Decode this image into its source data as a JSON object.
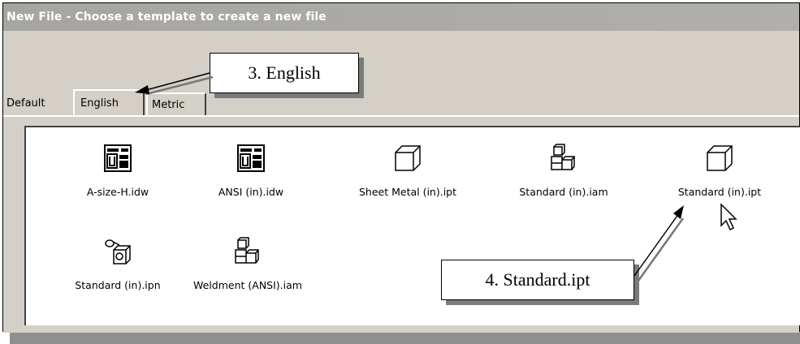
{
  "window": {
    "title": "New File - Choose a template to create a new file"
  },
  "tabs": [
    {
      "label": "Default",
      "selected": false
    },
    {
      "label": "English",
      "selected": true
    },
    {
      "label": "Metric",
      "selected": false
    }
  ],
  "templates": [
    {
      "label": "A-size-H.idw",
      "icon": "drawing-icon"
    },
    {
      "label": "ANSI (in).idw",
      "icon": "drawing-icon"
    },
    {
      "label": "Sheet Metal (in).ipt",
      "icon": "part-icon"
    },
    {
      "label": "Standard (in).iam",
      "icon": "assembly-icon"
    },
    {
      "label": "Standard (in).ipt",
      "icon": "part-icon"
    },
    {
      "label": "Standard (in).ipn",
      "icon": "presentation-icon"
    },
    {
      "label": "Weldment (ANSI).iam",
      "icon": "assembly-icon"
    }
  ],
  "callouts": {
    "english": "3. English",
    "standard_ipt": "4. Standard.ipt"
  }
}
